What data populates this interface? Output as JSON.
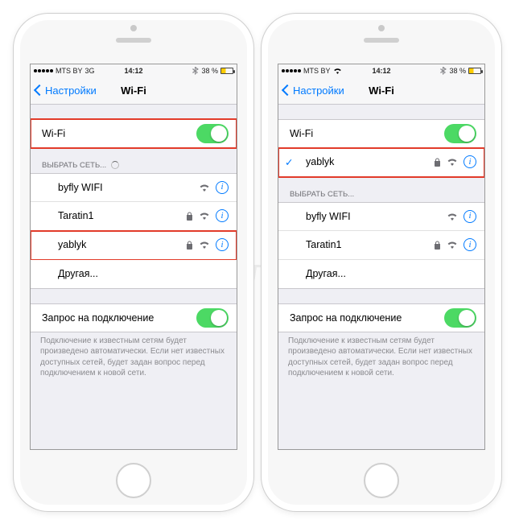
{
  "watermark": "Яблык",
  "statusbar": {
    "carrier": "MTS BY",
    "network": "3G",
    "time": "14:12",
    "battery_pct": "38 %"
  },
  "nav": {
    "back": "Настройки",
    "title": "Wi-Fi"
  },
  "wifi_row": {
    "label": "Wi-Fi"
  },
  "choose_header": "ВЫБРАТЬ СЕТЬ...",
  "networks": {
    "n0": {
      "name": "byfly WIFI",
      "locked": false
    },
    "n1": {
      "name": "Taratin1",
      "locked": true
    },
    "n2": {
      "name": "yablyk",
      "locked": true
    }
  },
  "other": "Другая...",
  "ask_row": {
    "label": "Запрос на подключение"
  },
  "footnote": "Подключение к известным сетям будет произведено автоматически. Если нет известных доступных сетей, будет задан вопрос перед подключением к новой сети."
}
